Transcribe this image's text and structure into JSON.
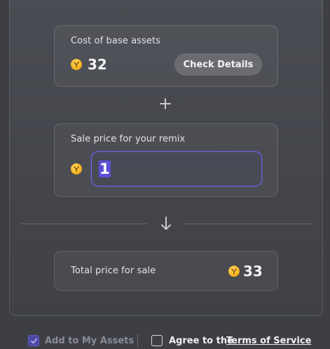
{
  "cost_card": {
    "label": "Cost of base assets",
    "value": "32",
    "details_button": "Check Details",
    "currency_icon": "coin-icon"
  },
  "plus_icon": "plus-icon",
  "sale_card": {
    "label": "Sale price for your remix",
    "input_value": "1",
    "currency_icon": "coin-icon"
  },
  "arrow_icon": "arrow-down-icon",
  "total_card": {
    "label": "Total price for sale",
    "value": "33",
    "currency_icon": "coin-icon"
  },
  "footer": {
    "add_to_assets_label": "Add to My Assets",
    "add_to_assets_checked": true,
    "agree_prefix": "Agree to the",
    "terms_link": "Terms of Service",
    "agree_checked": false
  },
  "colors": {
    "accent": "#6b63f0",
    "coin": "#f5b323",
    "background": "#3d3f45"
  }
}
